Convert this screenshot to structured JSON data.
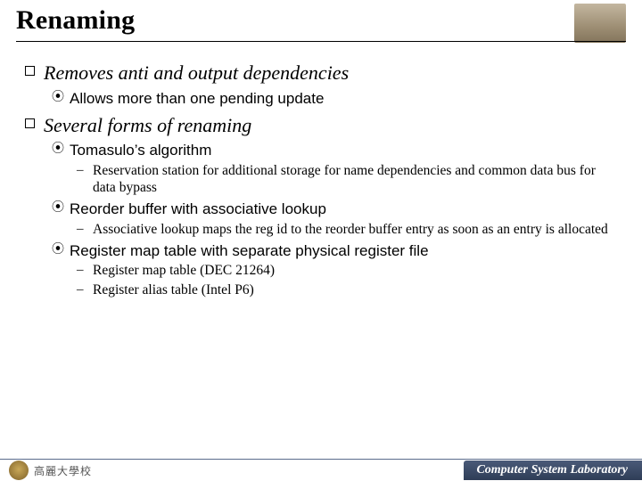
{
  "title": "Renaming",
  "bullets": {
    "b1": "Removes anti and output dependencies",
    "b1_1": "Allows more than one pending update",
    "b2": "Several forms of renaming",
    "b2_1": "Tomasulo’s algorithm",
    "b2_1_1": "Reservation station for additional storage for name dependencies and common data bus for data bypass",
    "b2_2": "Reorder buffer with associative lookup",
    "b2_2_1": "Associative lookup maps the reg id to the reorder buffer entry as soon as an entry is allocated",
    "b2_3": "Register map table with separate physical register file",
    "b2_3_1": "Register map table (DEC 21264)",
    "b2_3_2": "Register alias table (Intel P6)"
  },
  "glyphs": {
    "lvl2": "⦿",
    "lvl3": "–"
  },
  "footer": {
    "left": "高麗大學校",
    "right": "Computer System Laboratory"
  }
}
